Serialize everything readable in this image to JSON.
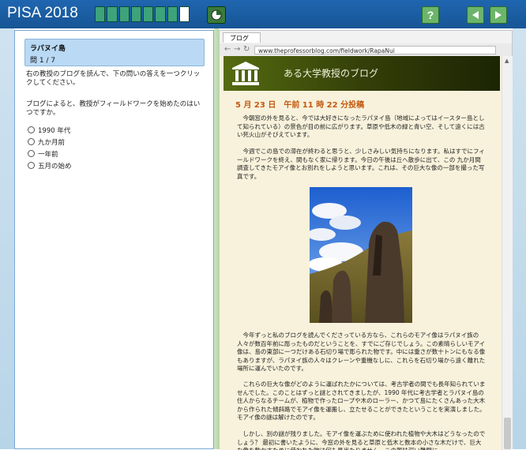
{
  "app": {
    "title": "PISA 2018"
  },
  "progress": {
    "total": 8,
    "completed": 7,
    "current": 8
  },
  "toolbar": {
    "help_label": "?",
    "back_icon": "triangle-left-icon",
    "forward_icon": "triangle-right-icon"
  },
  "left": {
    "unit_title": "ラパヌイ島",
    "question_count": "問 1 / 7",
    "instruction": "右の教授のブログを読んで、下の問いの答えを一つクリックしてください。",
    "question": "ブログによると、教授がフィールドワークを始めたのはいつですか。",
    "options": [
      "1990 年代",
      "九か月前",
      "一年前",
      "五月の始め"
    ]
  },
  "browser": {
    "tab_label": "ブログ",
    "url": "www.theprofessorblog.com/fieldwork/RapaNui",
    "blog_title": "ある大学教授のブログ",
    "post_date": "5 月 23 日　午前 11 時 22 分投稿",
    "paragraphs": [
      "今朝窓の外を見ると、今では大好きになったラパヌイ島（地域によってはイースター島として知られている）の景色が目の前に広がります。草原や低木の緑と青い空、そして遠くには古い死火山がそびえています。",
      "今週でこの島での滞在が終わると思うと、少しさみしい気持ちになります。私はすでにフィールドワークを終え、間もなく家に帰ります。今日の午後は丘へ散歩に出て、この 九か月間調査してきたモアイ像とお別れをしようと思います。これは、その巨大な像の一部を撮った写真です。",
      "今年ずっと私のブログを読んでくださっている方なら、これらのモアイ像はラパヌイ族の人々が数百年前に彫ったものだということを、すでにご存じでしょう。この素晴らしいモアイ像は、島の東部に一つだけある石切り場で彫られた物です。中には重さが数十トンにもなる像もありますが、ラパヌイ族の人々はクレーンや重機なしに、これらを石切り場から遠く離れた場所に運んでいたのです。",
      "これらの巨大な像がどのように運ばれたかについては、考古学者の間でも長年知られていませんでした。このことはずっと謎とされてきましたが、1990 年代に考古学者とラパヌイ島の住人からなるチームが、植物で作ったロープや木のローラー、かつて島にたくさんあった大木から作られた傾斜路でモアイ像を運搬し、立たせることができたということを実演しました。モアイ像の謎は解けたのです。",
      "しかし、別の謎が残りました。モアイ像を運ぶために使われた植物や大木はどうなったのでしょう？ 最初に書いたように、今窓の外を見ると草原と低木と数本の小さな木だけで、巨大な像を動かすために使われた物は何も見当たりません。この興味深い難問に"
    ]
  }
}
